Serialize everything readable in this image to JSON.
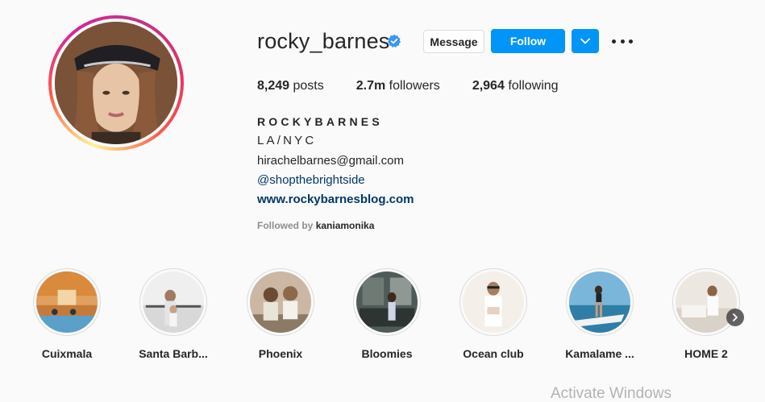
{
  "profile": {
    "username": "rocky_barnes",
    "verified": true,
    "avatar_icon": "profile-photo"
  },
  "actions": {
    "message_label": "Message",
    "follow_label": "Follow",
    "dropdown_icon": "chevron-down-icon",
    "more_icon": "more-horizontal-icon",
    "accent_color": "#0095f6"
  },
  "stats": {
    "posts_count": "8,249",
    "posts_label": "posts",
    "followers_count": "2.7m",
    "followers_label": "followers",
    "following_count": "2,964",
    "following_label": "following"
  },
  "bio": {
    "name": "ROCKYBARNES",
    "location": "LA/NYC",
    "email": "hirachelbarnes@gmail.com",
    "handle": "@shopthebrightside",
    "website": "www.rockybarnesblog.com",
    "followed_by_prefix": "Followed by",
    "followed_by_user": "kaniamonika"
  },
  "highlights": [
    {
      "label": "Cuixmala"
    },
    {
      "label": "Santa Barb..."
    },
    {
      "label": "Phoenix"
    },
    {
      "label": "Bloomies"
    },
    {
      "label": "Ocean club"
    },
    {
      "label": "Kamalame ..."
    },
    {
      "label": "HOME 2"
    }
  ],
  "overlay": {
    "watermark": "Activate Windows"
  }
}
